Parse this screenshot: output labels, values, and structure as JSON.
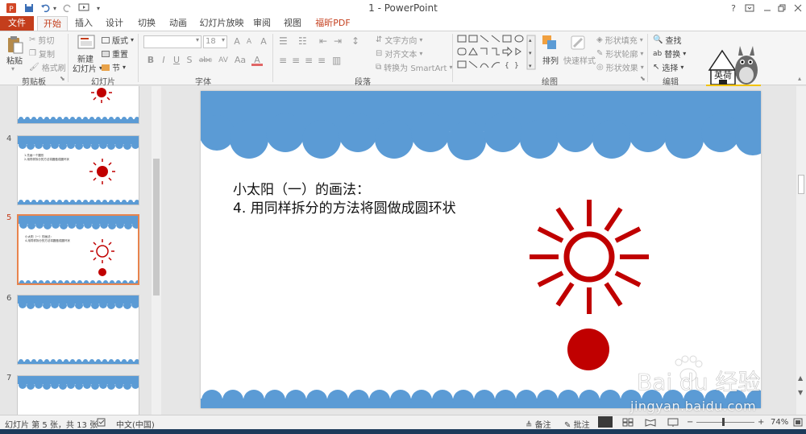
{
  "window": {
    "title": "1 - PowerPoint",
    "help": "?"
  },
  "tabs": [
    {
      "label": "文件"
    },
    {
      "label": "开始"
    },
    {
      "label": "插入"
    },
    {
      "label": "设计"
    },
    {
      "label": "切换"
    },
    {
      "label": "动画"
    },
    {
      "label": "幻灯片放映"
    },
    {
      "label": "审阅"
    },
    {
      "label": "视图"
    },
    {
      "label": "福昕PDF"
    }
  ],
  "ribbon": {
    "clipboard": {
      "paste": "粘贴",
      "cut": "剪切",
      "copy": "复制",
      "format_painter": "格式刷",
      "label": "剪贴板"
    },
    "slides": {
      "new_slide": "新建",
      "new_slide_2": "幻灯片",
      "layout": "版式",
      "reset": "重置",
      "section": "节",
      "label": "幻灯片"
    },
    "font": {
      "size": "18",
      "label": "字体",
      "bold": "B",
      "italic": "I",
      "underline": "U",
      "strike": "S",
      "shadow": "abc",
      "spacing": "AV",
      "case": "Aa",
      "color": "A",
      "grow": "A",
      "shrink": "A",
      "clear": "A"
    },
    "paragraph": {
      "text_direction": "文字方向",
      "align_text": "对齐文本",
      "smartart": "转换为 SmartArt",
      "label": "段落"
    },
    "drawing": {
      "arrange": "排列",
      "quick_styles": "快速样式",
      "shape_fill": "形状填充",
      "shape_outline": "形状轮廓",
      "shape_effects": "形状效果",
      "label": "绘图"
    },
    "editing": {
      "find": "查找",
      "replace": "替换",
      "select": "选择",
      "label": "编辑"
    }
  },
  "thumbnails": [
    {
      "num": "",
      "text1": "",
      "text2": ""
    },
    {
      "num": "4",
      "text1": "1.先画一个圆形",
      "text2": "2.用同样拆分的方法将圆做成圆环状"
    },
    {
      "num": "5",
      "text1": "小太阳（一）的画法：",
      "text2": "4.用同样拆分的方法将圆做成圆环状"
    },
    {
      "num": "6",
      "text1": "",
      "text2": ""
    },
    {
      "num": "7",
      "text1": "",
      "text2": ""
    }
  ],
  "slide": {
    "line1": "小太阳（一）的画法：",
    "line2": "4. 用同样拆分的方法将圆做成圆环状"
  },
  "status": {
    "slide_info": "幻灯片 第 5 张，共 13 张",
    "language": "中文(中国)",
    "notes": "备注",
    "comments": "批注",
    "zoom": "74%"
  },
  "watermark": {
    "logo_text": "Bai du 经验",
    "url": "jingyan.baidu.com",
    "avatar_text": "英荷"
  },
  "colors": {
    "accent": "#c43e1c",
    "cloud": "#5b9bd5",
    "sun": "#c00000"
  }
}
